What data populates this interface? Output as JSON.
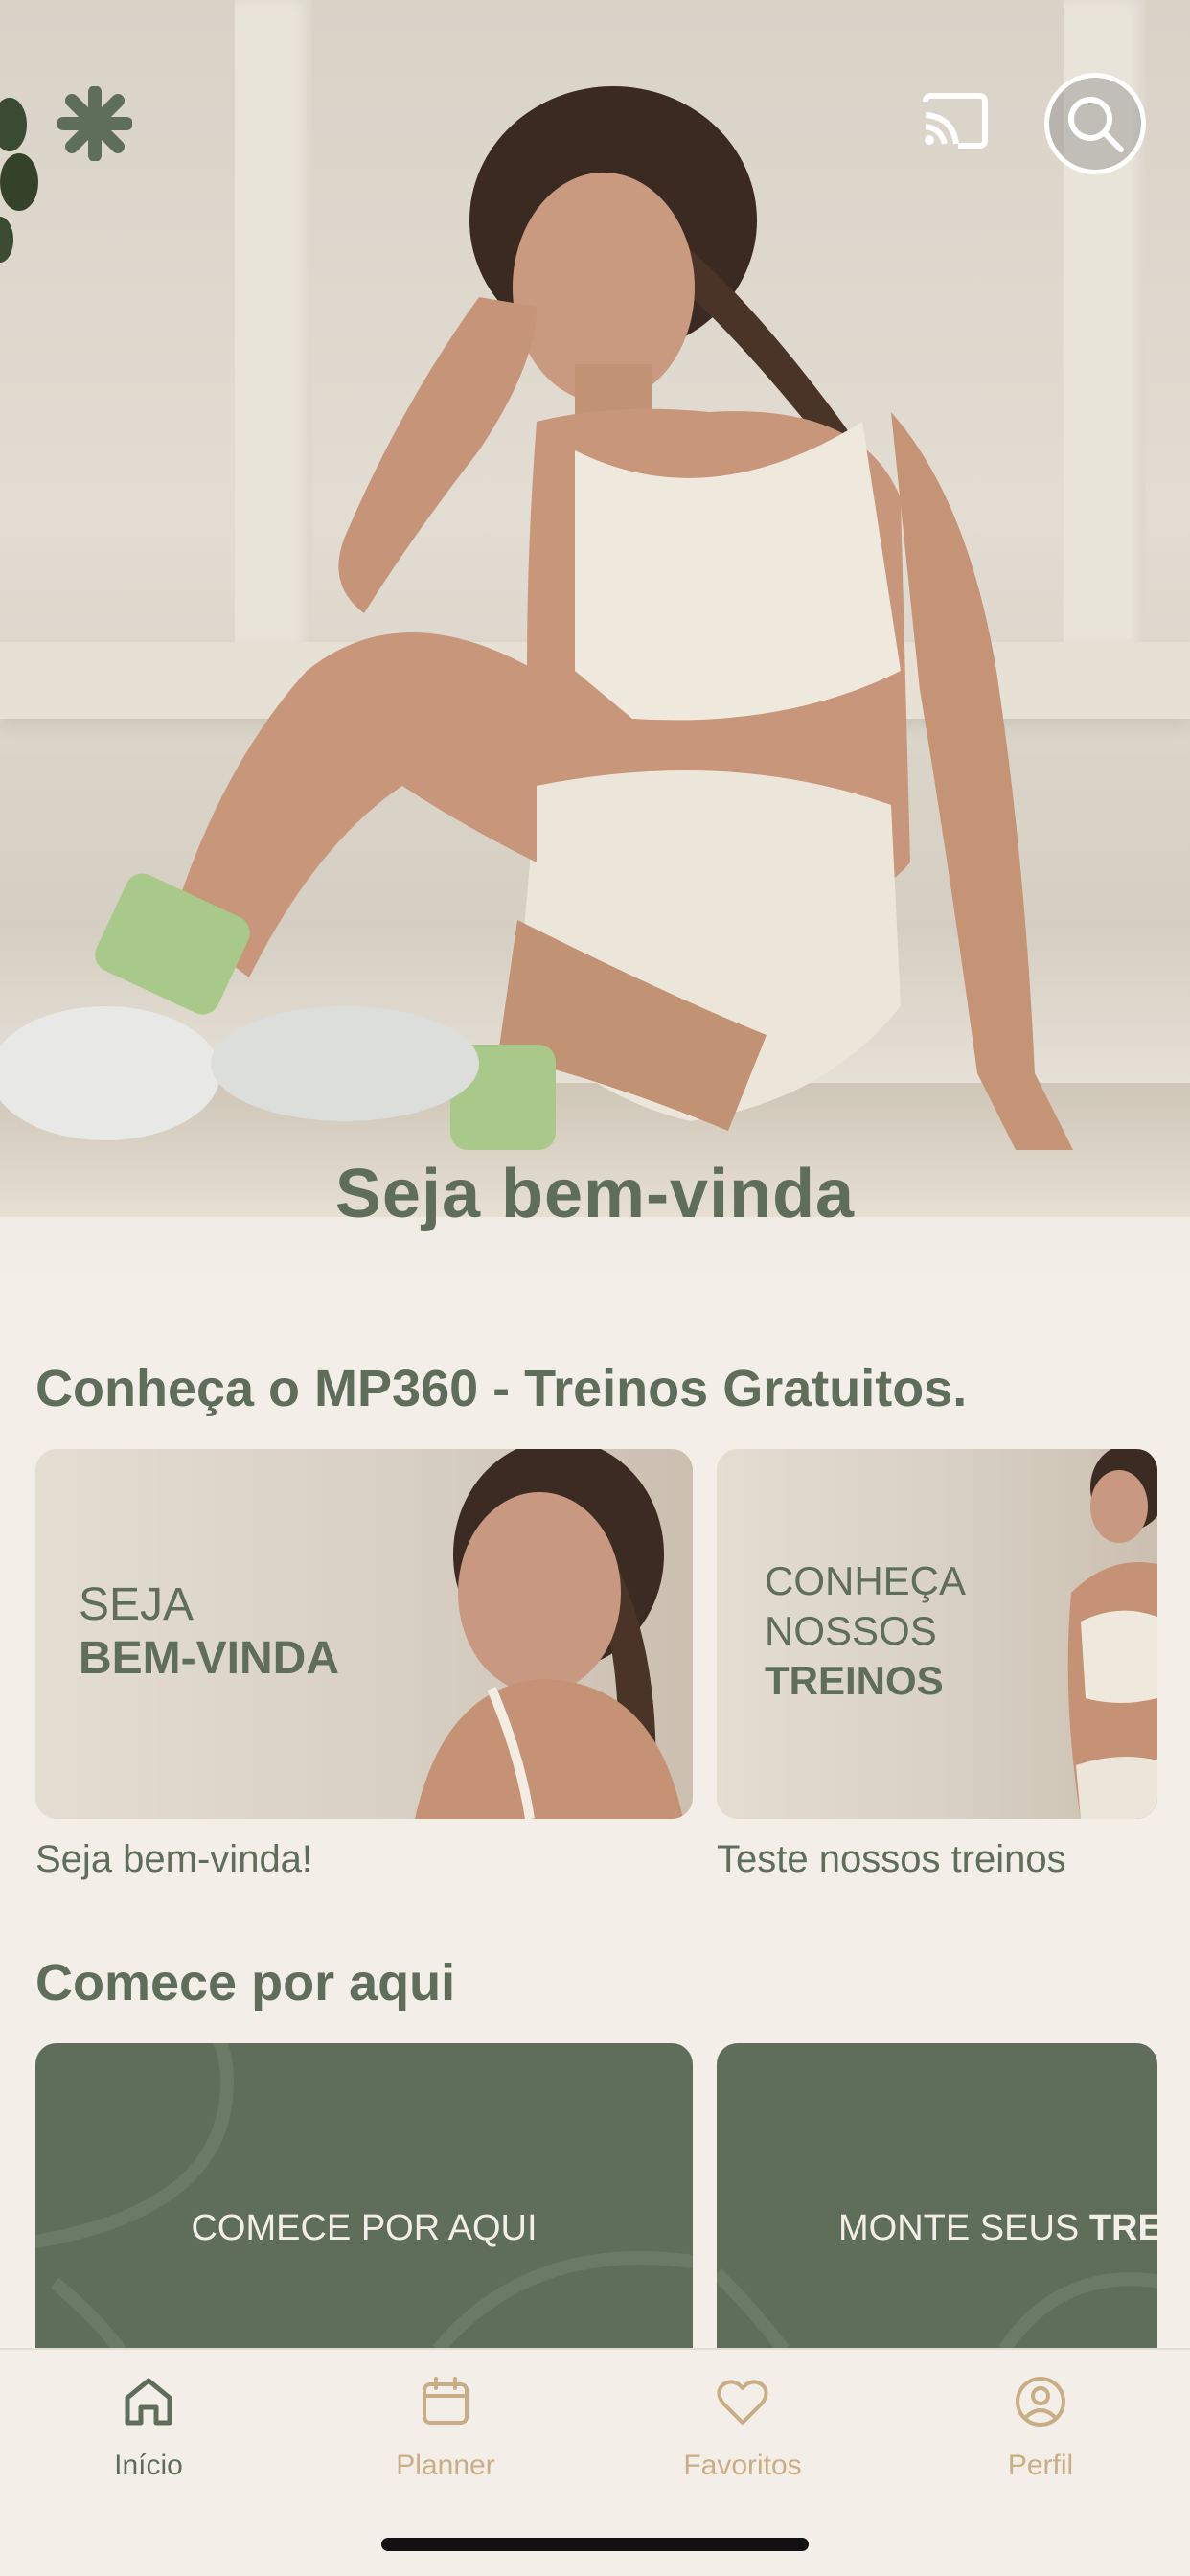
{
  "hero": {
    "title": "Seja bem-vinda"
  },
  "header": {
    "logo_icon": "asterisk-logo-icon",
    "cast_icon": "cast-icon",
    "search_icon": "search-icon"
  },
  "sections": {
    "free": {
      "title": "Conheça o MP360 - Treinos Gratuitos.",
      "cards": [
        {
          "line1": "SEJA",
          "line2": "BEM-VINDA",
          "caption": "Seja bem-vinda!"
        },
        {
          "line1": "CONHEÇA",
          "line2": "NOSSOS",
          "line3": "TREINOS",
          "caption": "Teste nossos treinos"
        }
      ]
    },
    "start": {
      "title": "Comece por aqui",
      "cards": [
        {
          "label": "COMECE POR AQUI"
        },
        {
          "label_regular": "MONTE SEUS ",
          "label_bold": "TRE"
        }
      ]
    }
  },
  "tabbar": {
    "items": [
      {
        "label": "Início",
        "icon": "home-icon",
        "active": true
      },
      {
        "label": "Planner",
        "icon": "calendar-icon",
        "active": false
      },
      {
        "label": "Favoritos",
        "icon": "heart-icon",
        "active": false
      },
      {
        "label": "Perfil",
        "icon": "profile-icon",
        "active": false
      }
    ]
  },
  "colors": {
    "brand_green": "#5e6e5a",
    "background": "#f3efe8",
    "tab_inactive": "#c9ad86"
  }
}
